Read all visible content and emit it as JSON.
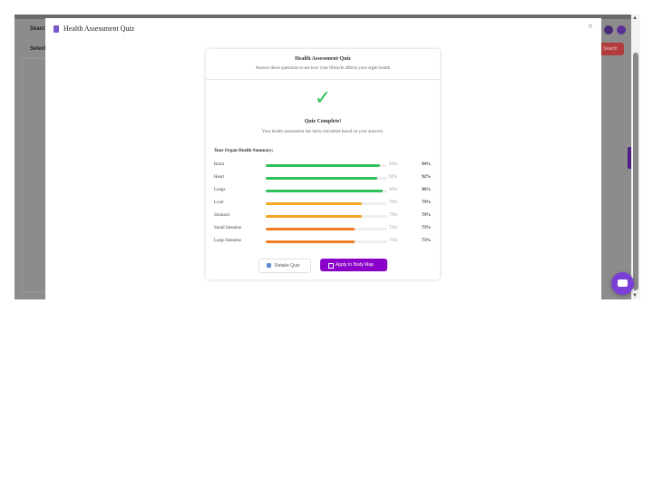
{
  "background": {
    "search_label": "Search",
    "select_label": "Select",
    "search_button": "Search"
  },
  "modal": {
    "title": "Health Assessment Quiz",
    "close_glyph": "×"
  },
  "card": {
    "title": "Health Assessment Quiz",
    "subtitle": "Answer these questions to see how your lifestyle affects your organ health",
    "check_glyph": "✓",
    "complete_title": "Quiz Complete!",
    "complete_text": "Your health assessment has been calculated based on your answers.",
    "summary_heading": "Your Organ Health Summary:"
  },
  "organs": [
    {
      "name": "Brain",
      "pct_label": "94%",
      "score": "94%",
      "value": 94,
      "color": "#2ec05a"
    },
    {
      "name": "Heart",
      "pct_label": "92%",
      "score": "92%",
      "value": 92,
      "color": "#2ec05a"
    },
    {
      "name": "Lungs",
      "pct_label": "96%",
      "score": "96%",
      "value": 96,
      "color": "#2ec05a"
    },
    {
      "name": "Liver",
      "pct_label": "79%",
      "score": "79%",
      "value": 79,
      "color": "#f5a623"
    },
    {
      "name": "Stomach",
      "pct_label": "79%",
      "score": "79%",
      "value": 79,
      "color": "#f5a623"
    },
    {
      "name": "Small Intestine",
      "pct_label": "73%",
      "score": "73%",
      "value": 73,
      "color": "#f07b22"
    },
    {
      "name": "Large Intestine",
      "pct_label": "73%",
      "score": "73%",
      "value": 73,
      "color": "#f07b22"
    }
  ],
  "buttons": {
    "retake": "Retake Quiz",
    "apply": "Apply to Body Map"
  },
  "icons": {
    "modal": "quiz-book-icon",
    "retake": "refresh-icon",
    "apply": "body-map-icon",
    "fab": "chat-icon"
  }
}
